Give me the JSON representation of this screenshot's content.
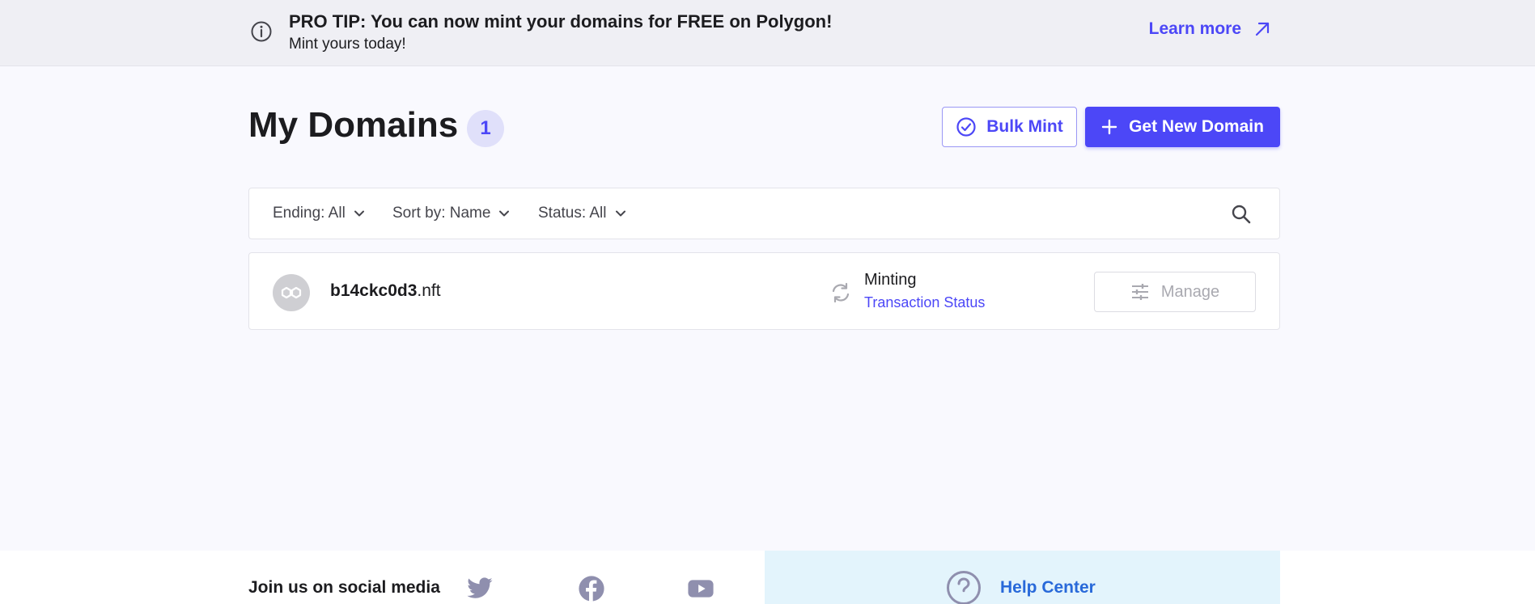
{
  "banner": {
    "title": "PRO TIP: You can now mint your domains for FREE on Polygon!",
    "subtitle": "Mint yours today!",
    "learn_more": "Learn more",
    "info_icon": "info-icon",
    "arrow_icon": "arrow-up-right-icon"
  },
  "header": {
    "title": "My Domains",
    "count": "1",
    "bulk_mint": "Bulk Mint",
    "get_new_domain": "Get New Domain"
  },
  "filters": {
    "ending": "Ending: All",
    "sort": "Sort by: Name",
    "status": "Status: All"
  },
  "domains": [
    {
      "name": "b14ckc0d3",
      "extension": ".nft",
      "chain_icon": "polygon-icon",
      "status": "Minting",
      "status_link": "Transaction Status",
      "manage": "Manage"
    }
  ],
  "footer": {
    "social_label": "Join us on social media",
    "social": [
      "twitter-icon",
      "facebook-icon",
      "youtube-icon"
    ],
    "help_center": "Help Center"
  },
  "colors": {
    "accent": "#4c47f7",
    "banner_bg": "#efeff4",
    "page_bg": "#f9f9fe",
    "help_bg": "#e3f4fc",
    "help_link": "#2869d9"
  }
}
